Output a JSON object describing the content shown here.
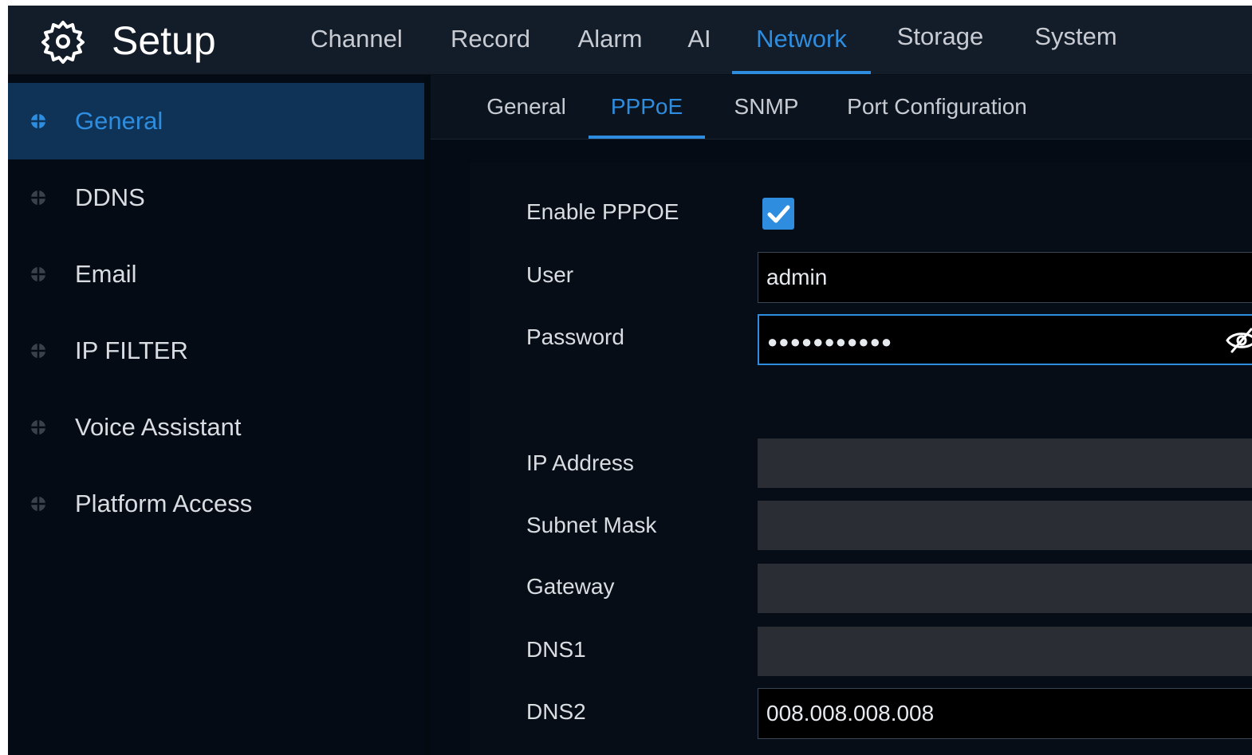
{
  "header": {
    "title": "Setup",
    "tabs": [
      {
        "label": "Channel"
      },
      {
        "label": "Record"
      },
      {
        "label": "Alarm"
      },
      {
        "label": "AI"
      },
      {
        "label": "Network",
        "active": true
      },
      {
        "label": "Storage"
      },
      {
        "label": "System"
      }
    ]
  },
  "sidebar": {
    "items": [
      {
        "label": "General",
        "active": true
      },
      {
        "label": "DDNS"
      },
      {
        "label": "Email"
      },
      {
        "label": "IP FILTER"
      },
      {
        "label": "Voice Assistant"
      },
      {
        "label": "Platform Access"
      }
    ]
  },
  "subtabs": [
    {
      "label": "General"
    },
    {
      "label": "PPPoE",
      "active": true
    },
    {
      "label": "SNMP"
    },
    {
      "label": "Port Configuration"
    }
  ],
  "form": {
    "enable_label": "Enable PPPOE",
    "enable_checked": true,
    "user_label": "User",
    "user_value": "admin",
    "password_label": "Password",
    "password_value": "●●●●●●●●●●●",
    "ip_label": "IP Address",
    "ip_value": "",
    "subnet_label": "Subnet Mask",
    "subnet_value": "",
    "gateway_label": "Gateway",
    "gateway_value": "",
    "dns1_label": "DNS1",
    "dns1_value": "",
    "dns2_label": "DNS2",
    "dns2_value": "008.008.008.008"
  },
  "colors": {
    "accent": "#2e8ddf",
    "header_bg": "#131d2a",
    "sidebar_active_bg": "#0e3357",
    "disabled_field": "#2a2e34"
  },
  "icons": {
    "app": "gear-icon",
    "sidebar": "diamond-dot-icon",
    "password_toggle": "eye-off-icon",
    "checkbox": "checkmark-icon"
  }
}
